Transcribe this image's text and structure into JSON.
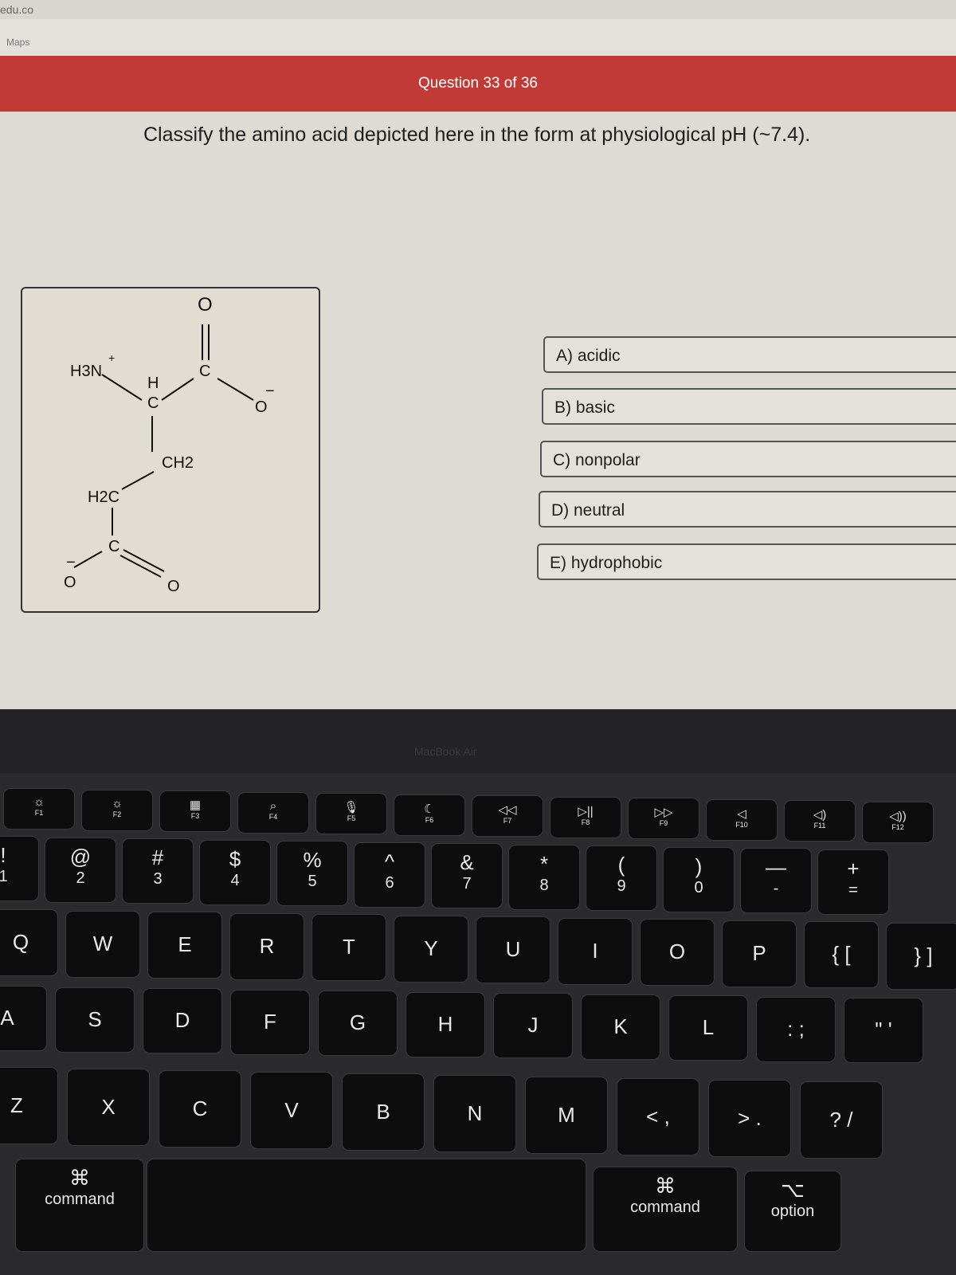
{
  "browser": {
    "url_fragment": "edu.co",
    "bookmark": "Maps"
  },
  "banner": {
    "title": "Question 33 of 36",
    "color": "#c23a36"
  },
  "question": "Classify the amino acid depicted here in the form at physiological pH (~7.4).",
  "molecule": {
    "h3n": "H3N",
    "plus": "+",
    "h": "H",
    "c_alpha": "C",
    "c_carboxyl": "C",
    "o_top": "O",
    "o_minus": "O",
    "minus": "−",
    "ch2": "CH2",
    "h2c": "H2C",
    "c_side": "C",
    "o_side_minus": "O",
    "o_side": "O"
  },
  "options": [
    "A) acidic",
    "B) basic",
    "C) nonpolar",
    "D) neutral",
    "E) hydrophobic"
  ],
  "bezel_label": "MacBook Air",
  "keyboard": {
    "fn_row": [
      [
        "☼",
        "F1"
      ],
      [
        "☼",
        "F2"
      ],
      [
        "▦",
        "F3"
      ],
      [
        "⌕",
        "F4"
      ],
      [
        "🎙",
        "F5"
      ],
      [
        "☾",
        "F6"
      ],
      [
        "◁◁",
        "F7"
      ],
      [
        "▷||",
        "F8"
      ],
      [
        "▷▷",
        "F9"
      ],
      [
        "◁",
        "F10"
      ],
      [
        "◁)",
        "F11"
      ],
      [
        "◁))",
        "F12"
      ]
    ],
    "num_row": [
      [
        "!",
        "1"
      ],
      [
        "@",
        "2"
      ],
      [
        "#",
        "3"
      ],
      [
        "$",
        "4"
      ],
      [
        "%",
        "5"
      ],
      [
        "^",
        "6"
      ],
      [
        "&",
        "7"
      ],
      [
        "*",
        "8"
      ],
      [
        "(",
        "9"
      ],
      [
        ")",
        "0"
      ],
      [
        "—",
        "-"
      ],
      [
        "+",
        "="
      ]
    ],
    "row_q": [
      "Q",
      "W",
      "E",
      "R",
      "T",
      "Y",
      "U",
      "I",
      "O",
      "P",
      "{ [",
      "} ]"
    ],
    "row_a": [
      "A",
      "S",
      "D",
      "F",
      "G",
      "H",
      "J",
      "K",
      "L",
      ": ;",
      "\" '"
    ],
    "row_z": [
      "Z",
      "X",
      "C",
      "V",
      "B",
      "N",
      "M",
      "< ,",
      "> .",
      "? /"
    ],
    "bottom": [
      "⌘",
      "command",
      "⌘",
      "command",
      "⌥",
      "option"
    ]
  }
}
